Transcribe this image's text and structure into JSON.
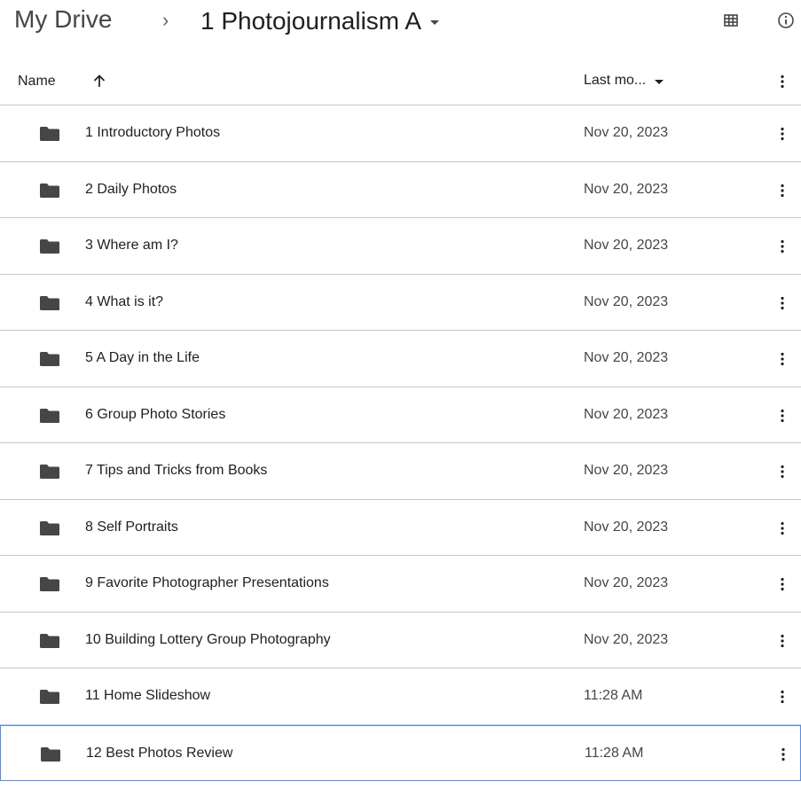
{
  "breadcrumb": {
    "root": "My Drive",
    "separator": "›",
    "current": "1 Photojournalism A"
  },
  "icons": {
    "grid_view": "grid-view-icon",
    "info": "info-icon",
    "sort": "arrow-up-icon",
    "more": "more-vert-icon",
    "folder": "folder-icon"
  },
  "columns": {
    "name": "Name",
    "last_modified": "Last mo..."
  },
  "colors": {
    "folder": "#444746",
    "divider": "#c7c7c7",
    "selection": "#4c8dfd"
  },
  "files": [
    {
      "name": "1 Introductory Photos",
      "modified": "Nov 20, 2023"
    },
    {
      "name": "2 Daily Photos",
      "modified": "Nov 20, 2023"
    },
    {
      "name": "3 Where am I?",
      "modified": "Nov 20, 2023"
    },
    {
      "name": "4 What is it?",
      "modified": "Nov 20, 2023"
    },
    {
      "name": "5 A Day in the Life",
      "modified": "Nov 20, 2023"
    },
    {
      "name": "6 Group Photo Stories",
      "modified": "Nov 20, 2023"
    },
    {
      "name": "7 Tips and Tricks from Books",
      "modified": "Nov 20, 2023"
    },
    {
      "name": "8 Self Portraits",
      "modified": "Nov 20, 2023"
    },
    {
      "name": "9 Favorite Photographer Presentations",
      "modified": "Nov 20, 2023"
    },
    {
      "name": "10 Building Lottery Group Photography",
      "modified": "Nov 20, 2023"
    },
    {
      "name": "11 Home Slideshow",
      "modified": "11:28 AM"
    },
    {
      "name": "12 Best Photos Review",
      "modified": "11:28 AM",
      "selected": true
    }
  ]
}
